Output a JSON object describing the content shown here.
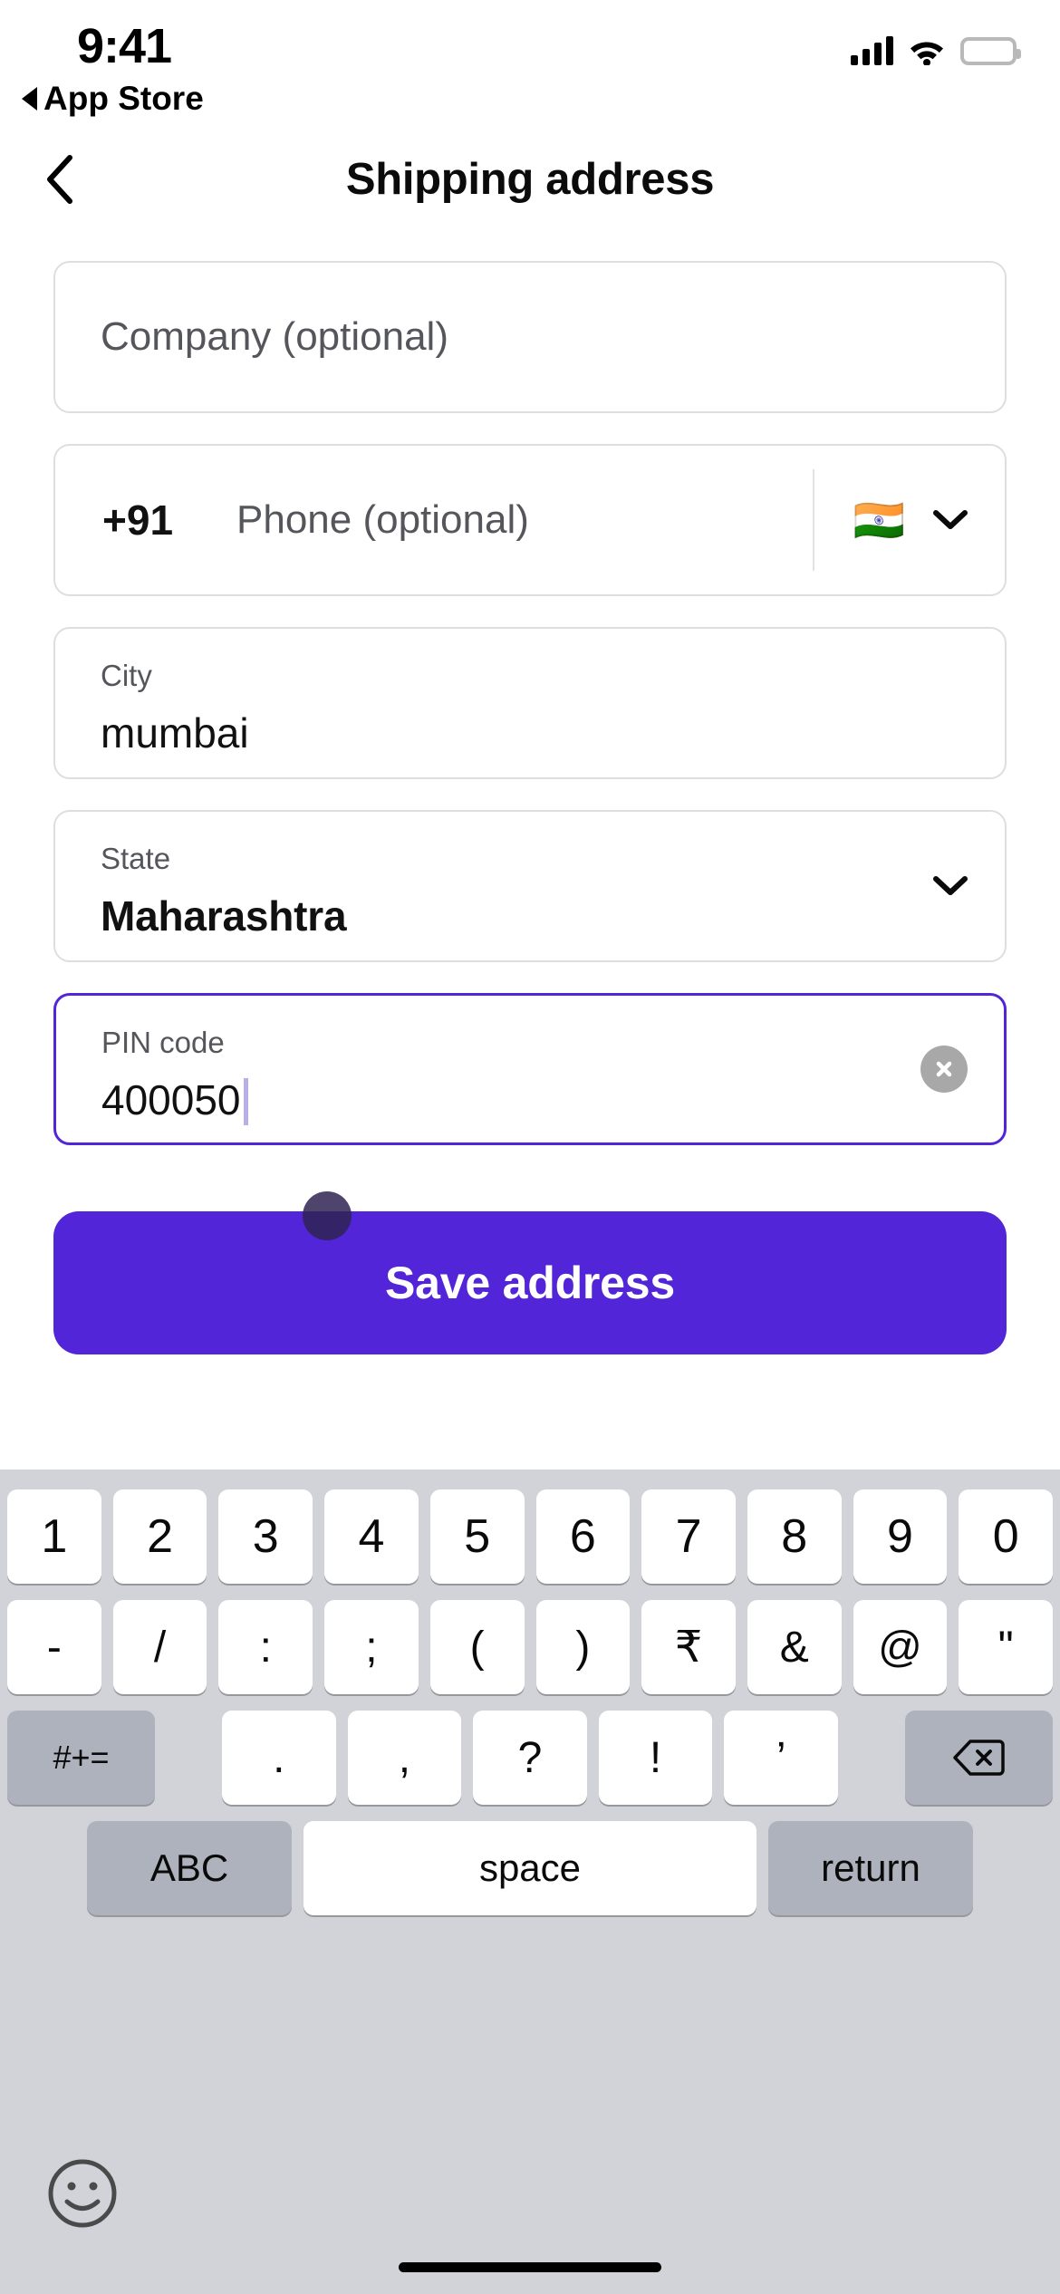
{
  "status_bar": {
    "time": "9:41",
    "back_app_label": "App Store",
    "icons": [
      "cellular-signal-icon",
      "wifi-icon",
      "battery-icon"
    ]
  },
  "nav": {
    "back_icon": "chevron-left-icon",
    "title": "Shipping address"
  },
  "form": {
    "fields": [
      {
        "name": "company",
        "placeholder": "Company (optional)",
        "value": "",
        "focused": false
      },
      {
        "name": "phone",
        "country_code": "+91",
        "placeholder": "Phone (optional)",
        "value": "",
        "flag": "🇮🇳",
        "dropdown_icon": "chevron-down-icon",
        "focused": false
      },
      {
        "name": "city",
        "label": "City",
        "value": "mumbai",
        "focused": false
      },
      {
        "name": "state",
        "label": "State",
        "value": "Maharashtra",
        "dropdown_icon": "chevron-down-icon",
        "focused": false
      },
      {
        "name": "pin_code",
        "label": "PIN code",
        "value": "400050",
        "clear_icon": "clear-circle-icon",
        "focused": true
      }
    ]
  },
  "primary_action": {
    "label": "Save address",
    "color": "#5325d9",
    "text_color": "#ffffff"
  },
  "keyboard": {
    "type": "numeric-symbols",
    "row1": [
      "1",
      "2",
      "3",
      "4",
      "5",
      "6",
      "7",
      "8",
      "9",
      "0"
    ],
    "row2": [
      "-",
      "/",
      ":",
      ";",
      "(",
      ")",
      "₹",
      "&",
      "@",
      "\""
    ],
    "row3": {
      "shift_label": "#+=",
      "keys": [
        ".",
        ",",
        "?",
        "!",
        "’"
      ],
      "backspace_icon": "backspace-icon"
    },
    "row4": {
      "abc_label": "ABC",
      "space_label": "space",
      "return_label": "return"
    },
    "emoji_icon": "emoji-smiley-icon"
  },
  "theme": {
    "accent": "#5325d9",
    "field_border": "#dedede",
    "focus_border": "#5325d9",
    "placeholder_text": "#55565c",
    "value_text": "#111111",
    "keyboard_bg": "#d1d3d9",
    "key_bg": "#ffffff",
    "key_dark_bg": "#aeb2bd"
  }
}
